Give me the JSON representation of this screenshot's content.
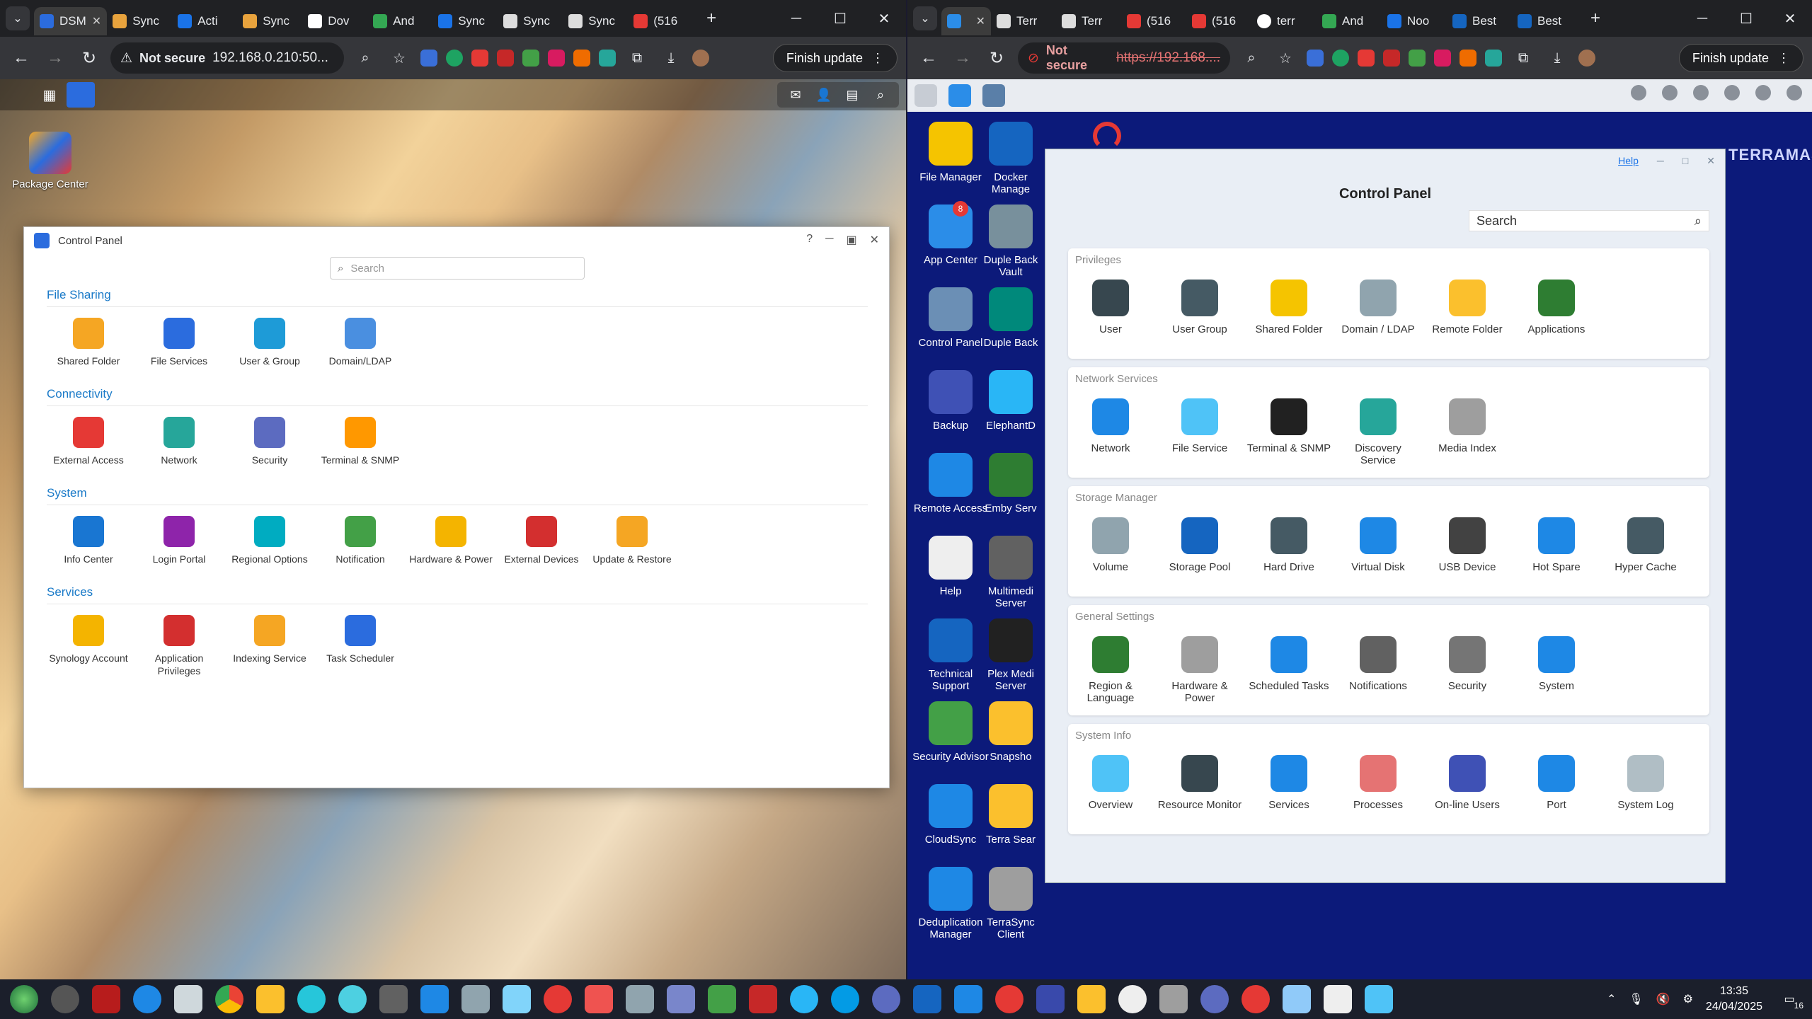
{
  "left_browser": {
    "tabs": [
      {
        "label": "DSM",
        "active": true
      },
      {
        "label": "Sync"
      },
      {
        "label": "Acti"
      },
      {
        "label": "Sync"
      },
      {
        "label": "Dov"
      },
      {
        "label": "And"
      },
      {
        "label": "Sync"
      },
      {
        "label": "Sync"
      },
      {
        "label": "Sync"
      },
      {
        "label": "(516"
      }
    ],
    "address": "192.168.0.210:50...",
    "security_label": "Not secure",
    "finish_update": "Finish update",
    "desktop_icons": [
      {
        "label": "Package Center"
      }
    ],
    "control_panel": {
      "title": "Control Panel",
      "search_placeholder": "Search",
      "sections": [
        {
          "title": "File Sharing",
          "items": [
            "Shared Folder",
            "File Services",
            "User & Group",
            "Domain/LDAP"
          ]
        },
        {
          "title": "Connectivity",
          "items": [
            "External Access",
            "Network",
            "Security",
            "Terminal & SNMP"
          ]
        },
        {
          "title": "System",
          "items": [
            "Info Center",
            "Login Portal",
            "Regional Options",
            "Notification",
            "Hardware & Power",
            "External Devices",
            "Update & Restore"
          ]
        },
        {
          "title": "Services",
          "items": [
            "Synology Account",
            "Application Privileges",
            "Indexing Service",
            "Task Scheduler"
          ]
        }
      ]
    }
  },
  "right_browser": {
    "tabs": [
      {
        "label": "",
        "active": true
      },
      {
        "label": "Terr"
      },
      {
        "label": "Terr"
      },
      {
        "label": "(516"
      },
      {
        "label": "(516"
      },
      {
        "label": "terr"
      },
      {
        "label": "And"
      },
      {
        "label": "Noo"
      },
      {
        "label": "Best"
      },
      {
        "label": "Best"
      }
    ],
    "address": "https://192.168....",
    "security_label": "Not secure",
    "finish_update": "Finish update",
    "desktop_icons_col1": [
      "File Manager",
      "App Center",
      "Control Panel",
      "Backup",
      "Remote Access",
      "Help",
      "Technical Support",
      "Security Advisor",
      "CloudSync",
      "Deduplication Manager"
    ],
    "desktop_icons_col2": [
      "Docker Manage",
      "Duple Back Vault",
      "Duple Back",
      "ElephantD",
      "Emby Serv",
      "Multimedi Server",
      "Plex Medi Server",
      "Snapsho",
      "Terra Sear",
      "TerraSync Client"
    ],
    "app_center_badge": "8",
    "brand": "TERRAMASTER",
    "control_panel": {
      "help": "Help",
      "title": "Control Panel",
      "search_placeholder": "Search",
      "groups": [
        {
          "title": "Privileges",
          "items": [
            "User",
            "User Group",
            "Shared Folder",
            "Domain / LDAP",
            "Remote Folder",
            "Applications"
          ]
        },
        {
          "title": "Network Services",
          "items": [
            "Network",
            "File Service",
            "Terminal & SNMP",
            "Discovery Service",
            "Media Index"
          ]
        },
        {
          "title": "Storage Manager",
          "items": [
            "Volume",
            "Storage Pool",
            "Hard Drive",
            "Virtual Disk",
            "USB Device",
            "Hot Spare",
            "Hyper Cache"
          ]
        },
        {
          "title": "General Settings",
          "items": [
            "Region & Language",
            "Hardware & Power",
            "Scheduled Tasks",
            "Notifications",
            "Security",
            "System"
          ]
        },
        {
          "title": "System Info",
          "items": [
            "Overview",
            "Resource Monitor",
            "Services",
            "Processes",
            "On-line Users",
            "Port",
            "System Log"
          ]
        }
      ]
    }
  },
  "taskbar": {
    "time": "13:35",
    "date": "24/04/2025",
    "notification_count": "16"
  },
  "colors": {
    "synology_section": "#1a7ac8",
    "terramaster_bg": "#0c1a7a",
    "chrome_dark": "#202124"
  }
}
